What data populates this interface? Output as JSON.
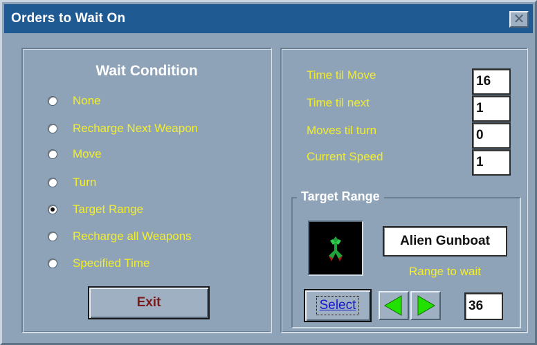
{
  "window": {
    "title": "Orders to Wait On",
    "close_glyph": "✕"
  },
  "wait_condition": {
    "title": "Wait Condition",
    "options": [
      {
        "label": "None",
        "checked": false
      },
      {
        "label": "Recharge Next Weapon",
        "checked": false
      },
      {
        "label": "Move",
        "checked": false
      },
      {
        "label": "Turn",
        "checked": false
      },
      {
        "label": "Target Range",
        "checked": true
      },
      {
        "label": "Recharge all Weapons",
        "checked": false
      },
      {
        "label": "Specified Time",
        "checked": false
      }
    ],
    "exit_label": "Exit"
  },
  "stats": {
    "time_til_move": {
      "label": "Time til Move",
      "value": "16"
    },
    "time_til_next": {
      "label": "Time til next",
      "value": "1"
    },
    "moves_til_turn": {
      "label": "Moves til turn",
      "value": "0"
    },
    "current_speed": {
      "label": "Current Speed",
      "value": "1"
    }
  },
  "target_range": {
    "title": "Target Range",
    "target_name": "Alien Gunboat",
    "range_label": "Range to wait",
    "select_label": "Select",
    "range_value": "36",
    "ship_icon": "alien-gunboat-icon",
    "arrow_left_icon": "arrow-left-icon",
    "arrow_right_icon": "arrow-right-icon"
  },
  "colors": {
    "title_bar": "#1f5a93",
    "background": "#8fa3b8",
    "label_yellow": "#f2ee2c",
    "exit_text": "#7a1a1a",
    "select_text": "#1515d0",
    "arrow_green": "#22e000"
  }
}
